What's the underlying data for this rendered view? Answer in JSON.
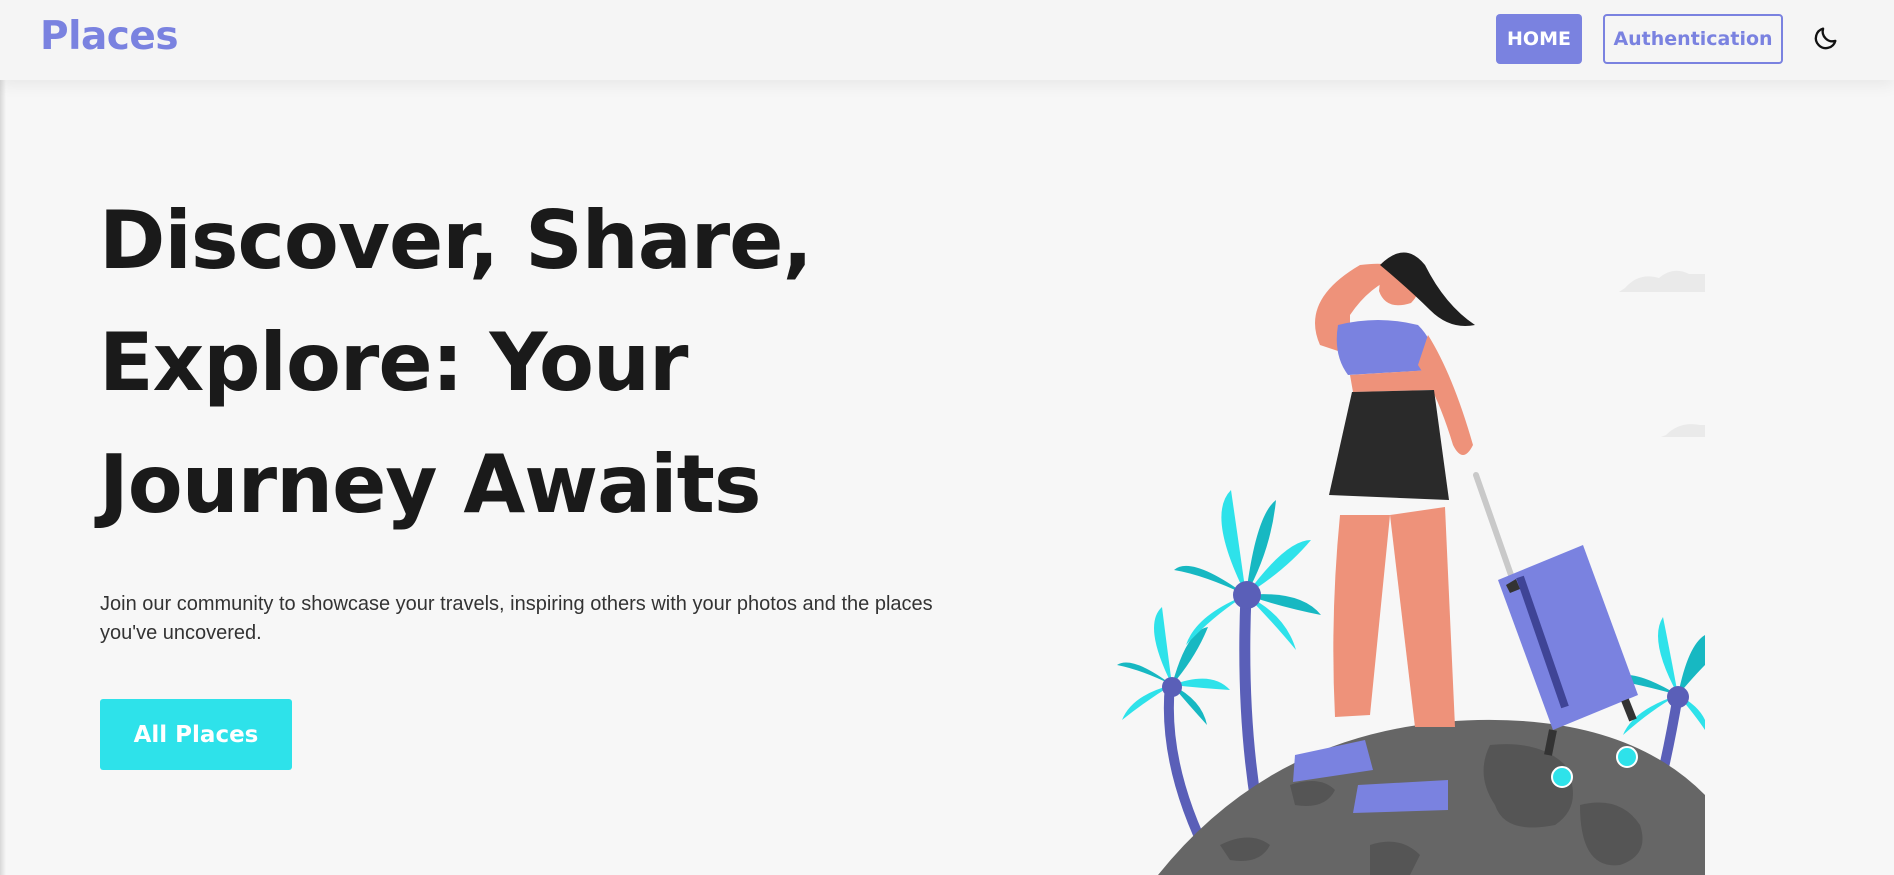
{
  "navbar": {
    "logo": "Places",
    "home_label": "HOME",
    "auth_label": "Authentication",
    "theme_icon": "moon-icon"
  },
  "hero": {
    "title_lines": [
      "Discover, Share,",
      "Explore: Your",
      "Journey Awaits"
    ],
    "description": "Join our community to showcase your travels, inspiring others with your photos and the places you've uncovered.",
    "cta_label": "All Places"
  },
  "colors": {
    "accent": "#7a82e0",
    "cta": "#2ee2ea",
    "title": "#1a1a1a",
    "background": "#f7f7f7"
  },
  "illustration": {
    "subject": "traveler-with-suitcase-on-globe-with-palm-trees"
  }
}
